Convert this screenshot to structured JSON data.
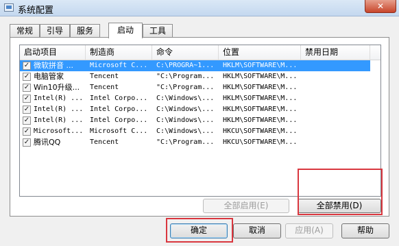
{
  "window": {
    "title": "系统配置",
    "close_glyph": "✕"
  },
  "tabs": [
    {
      "label": "常规"
    },
    {
      "label": "引导"
    },
    {
      "label": "服务"
    },
    {
      "label": "启动",
      "active": true
    },
    {
      "label": "工具"
    }
  ],
  "startup_table": {
    "columns": [
      "启动项目",
      "制造商",
      "命令",
      "位置",
      "禁用日期"
    ],
    "rows": [
      {
        "checked": true,
        "item": "微软拼音 ...",
        "maker": "Microsoft C...",
        "command": "C:\\PROGRA~1...",
        "location": "HKLM\\SOFTWARE\\M...",
        "disabled_date": "",
        "selected": true
      },
      {
        "checked": true,
        "item": "电脑管家",
        "maker": "Tencent",
        "command": "\"C:\\Program...",
        "location": "HKLM\\SOFTWARE\\M...",
        "disabled_date": ""
      },
      {
        "checked": true,
        "item": "Win10升级...",
        "maker": "Tencent",
        "command": "\"C:\\Program...",
        "location": "HKLM\\SOFTWARE\\M...",
        "disabled_date": ""
      },
      {
        "checked": true,
        "item": "Intel(R) ...",
        "maker": "Intel Corpo...",
        "command": "C:\\Windows\\...",
        "location": "HKLM\\SOFTWARE\\M...",
        "disabled_date": ""
      },
      {
        "checked": true,
        "item": "Intel(R) ...",
        "maker": "Intel Corpo...",
        "command": "C:\\Windows\\...",
        "location": "HKLM\\SOFTWARE\\M...",
        "disabled_date": ""
      },
      {
        "checked": true,
        "item": "Intel(R) ...",
        "maker": "Intel Corpo...",
        "command": "C:\\Windows\\...",
        "location": "HKLM\\SOFTWARE\\M...",
        "disabled_date": ""
      },
      {
        "checked": true,
        "item": "Microsoft...",
        "maker": "Microsoft C...",
        "command": "C:\\Windows\\...",
        "location": "HKCU\\SOFTWARE\\M...",
        "disabled_date": ""
      },
      {
        "checked": true,
        "item": "腾讯QQ",
        "maker": "Tencent",
        "command": "\"C:\\Program...",
        "location": "HKCU\\SOFTWARE\\M...",
        "disabled_date": ""
      }
    ]
  },
  "buttons": {
    "enable_all": "全部启用(E)",
    "disable_all": "全部禁用(D)",
    "ok": "确定",
    "cancel": "取消",
    "apply": "应用(A)",
    "help": "帮助"
  },
  "colors": {
    "highlight": "#d9363e",
    "selection": "#3399ff"
  }
}
